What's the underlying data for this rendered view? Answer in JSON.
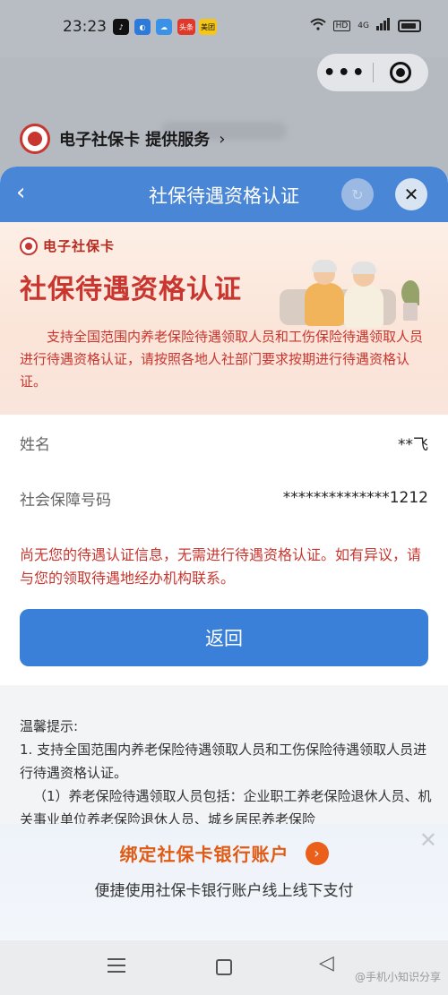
{
  "status_bar": {
    "time": "23:23",
    "notif_icons": [
      {
        "name": "tiktok-icon",
        "label": "♪",
        "color": "#111111"
      },
      {
        "name": "browser-icon",
        "label": "◐",
        "color": "#2d7ad9"
      },
      {
        "name": "weather-icon",
        "label": "☁",
        "color": "#3a92e8"
      },
      {
        "name": "toutiao-icon",
        "label": "头条",
        "color": "#e0392b"
      },
      {
        "name": "meituan-icon",
        "label": "美团",
        "color": "#f5c518"
      }
    ],
    "hd_label": "HD",
    "network_label": "4G"
  },
  "provider": {
    "text": "电子社保卡 提供服务",
    "chevron": "›"
  },
  "sheet": {
    "title": "社保待遇资格认证",
    "back": "‹",
    "close": "✕"
  },
  "hero": {
    "brand": "电子社保卡",
    "heading": "社保待遇资格认证",
    "description": "支持全国范围内养老保险待遇领取人员和工伤保险待遇领取人员进行待遇资格认证，请按照各地人社部门要求按期进行待遇资格认证。"
  },
  "info": {
    "name_label": "姓名",
    "name_value": "**飞",
    "ssn_label": "社会保障号码",
    "ssn_value": "**************1212",
    "notice": "尚无您的待遇认证信息，无需进行待遇资格认证。如有异议，请与您的领取待遇地经办机构联系。",
    "return_button": "返回"
  },
  "tips": {
    "title": "温馨提示:",
    "item1": "1. 支持全国范围内养老保险待遇领取人员和工伤保险待遇领取人员进行待遇资格认证。",
    "item1_sub": "（1）养老保险待遇领取人员包括：企业职工养老保险退休人员、机关事业单位养老保险退休人员、城乡居民养老保险"
  },
  "banner": {
    "headline": "绑定社保卡银行账户",
    "subline": "便捷使用社保卡银行账户线上线下支付",
    "arrow": "›",
    "close": "✕"
  },
  "navbar": {
    "back": "◁"
  },
  "watermark": "@手机小知识分享",
  "colors": {
    "accent_blue": "#3a7fd8",
    "header_blue": "#4a86d6",
    "alert_red": "#c8362f",
    "banner_orange": "#e05c16"
  }
}
